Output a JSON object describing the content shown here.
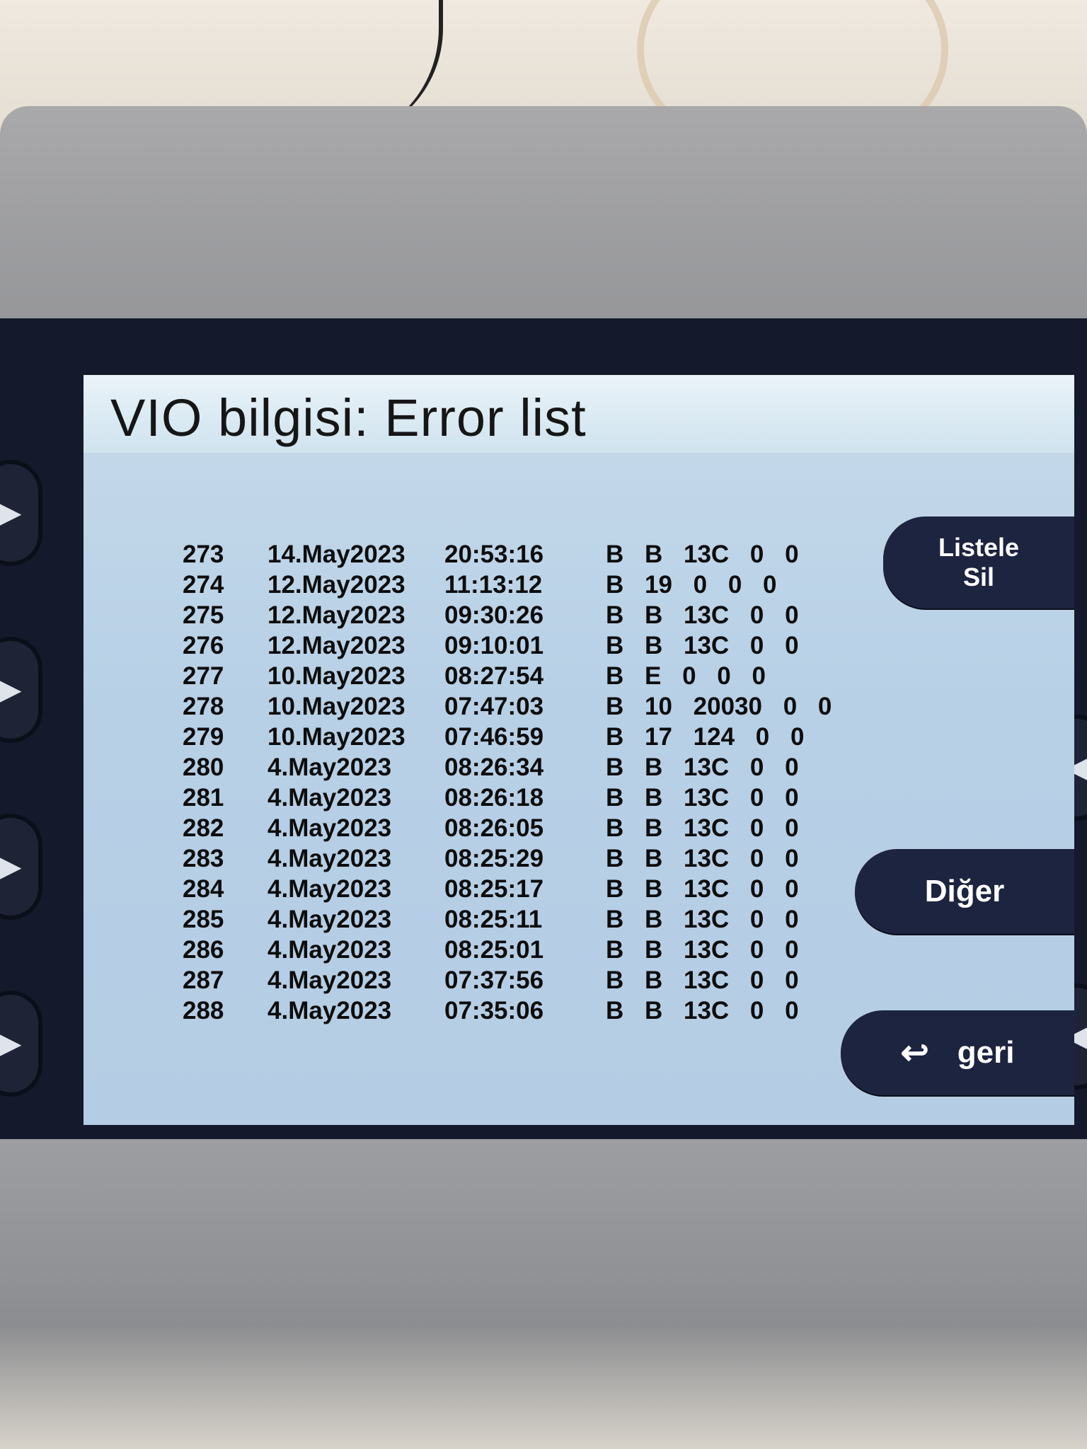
{
  "title": "VIO bilgisi: Error list",
  "buttons": {
    "listele_line1": "Listele",
    "listele_line2": "Sil",
    "diger": "Diğer",
    "geri": "geri"
  },
  "icons": {
    "back": "return-arrow-icon",
    "side": "arrow-right-icon"
  },
  "errors": [
    {
      "no": "273",
      "date": "14.May2023",
      "time": "20:53:16",
      "code": "B B 13C 0 0"
    },
    {
      "no": "274",
      "date": "12.May2023",
      "time": "11:13:12",
      "code": "B 19 0 0 0"
    },
    {
      "no": "275",
      "date": "12.May2023",
      "time": "09:30:26",
      "code": "B B 13C 0 0"
    },
    {
      "no": "276",
      "date": "12.May2023",
      "time": "09:10:01",
      "code": "B B 13C 0 0"
    },
    {
      "no": "277",
      "date": "10.May2023",
      "time": "08:27:54",
      "code": "B E 0 0 0"
    },
    {
      "no": "278",
      "date": "10.May2023",
      "time": "07:47:03",
      "code": "B 10 20030 0 0"
    },
    {
      "no": "279",
      "date": "10.May2023",
      "time": "07:46:59",
      "code": "B 17 124 0 0"
    },
    {
      "no": "280",
      "date": "4.May2023",
      "time": "08:26:34",
      "code": "B B 13C 0 0"
    },
    {
      "no": "281",
      "date": "4.May2023",
      "time": "08:26:18",
      "code": "B B 13C 0 0"
    },
    {
      "no": "282",
      "date": "4.May2023",
      "time": "08:26:05",
      "code": "B B 13C 0 0"
    },
    {
      "no": "283",
      "date": "4.May2023",
      "time": "08:25:29",
      "code": "B B 13C 0 0"
    },
    {
      "no": "284",
      "date": "4.May2023",
      "time": "08:25:17",
      "code": "B B 13C 0 0"
    },
    {
      "no": "285",
      "date": "4.May2023",
      "time": "08:25:11",
      "code": "B B 13C 0 0"
    },
    {
      "no": "286",
      "date": "4.May2023",
      "time": "08:25:01",
      "code": "B B 13C 0 0"
    },
    {
      "no": "287",
      "date": "4.May2023",
      "time": "07:37:56",
      "code": "B B 13C 0 0"
    },
    {
      "no": "288",
      "date": "4.May2023",
      "time": "07:35:06",
      "code": "B B 13C 0 0"
    }
  ]
}
